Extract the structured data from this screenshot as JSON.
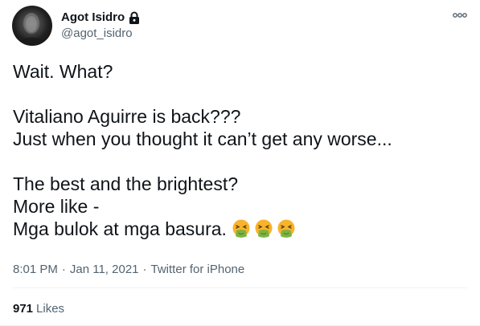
{
  "author": {
    "display_name": "Agot Isidro",
    "handle": "@agot_isidro",
    "protected": true
  },
  "tweet": {
    "lines": [
      "Wait. What?",
      "",
      "Vitaliano Aguirre is back???",
      "Just when you thought it can’t get any worse...",
      "",
      "The best and the brightest?",
      "More like -",
      "Mga bulok at mga basura."
    ],
    "emoji": [
      "vomiting-face-emoji",
      "vomiting-face-emoji",
      "vomiting-face-emoji"
    ]
  },
  "meta": {
    "time": "8:01 PM",
    "separator": "·",
    "date": "Jan 11, 2021",
    "source": "Twitter for iPhone"
  },
  "stats": {
    "likes_count": "971",
    "likes_label": "Likes"
  },
  "colors": {
    "text": "#0f1419",
    "secondary": "#536471",
    "divider": "#eff3f4",
    "emoji_face": "#f7b32b",
    "emoji_vomit": "#7cb342"
  }
}
